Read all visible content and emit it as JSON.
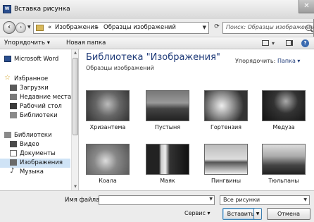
{
  "window": {
    "title": "Вставка рисунка",
    "close_glyph": "✕"
  },
  "address": {
    "prefix": "«",
    "crumbs": [
      "Изображения",
      "Образцы изображений"
    ],
    "separator": "▸"
  },
  "search": {
    "placeholder": "Поиск: Образцы изображений"
  },
  "toolbar": {
    "organize": "Упорядочить ▾",
    "new_folder": "Новая папка"
  },
  "sidebar": {
    "items": [
      {
        "label": "Microsoft Word",
        "icon": "word-icon",
        "bold": true
      },
      {
        "label": "Избранное",
        "icon": "star-icon"
      },
      {
        "label": "Загрузки",
        "icon": "downloads-icon"
      },
      {
        "label": "Недавние места",
        "icon": "recent-places-icon"
      },
      {
        "label": "Рабочий стол",
        "icon": "desktop-icon"
      },
      {
        "label": "Библиотеки",
        "icon": "library-icon"
      },
      {
        "label": "Библиотеки",
        "icon": "library-icon"
      },
      {
        "label": "Видео",
        "icon": "video-icon"
      },
      {
        "label": "Документы",
        "icon": "documents-icon"
      },
      {
        "label": "Изображения",
        "icon": "pictures-icon",
        "selected": true
      },
      {
        "label": "Музыка",
        "icon": "music-icon"
      }
    ]
  },
  "main": {
    "library_title": "Библиотека \"Изображения\"",
    "library_subtitle": "Образцы изображений",
    "arrange_label": "Упорядочить:",
    "arrange_value": "Папка ▾",
    "thumbnails": [
      {
        "caption": "Хризантема",
        "color": "#555555"
      },
      {
        "caption": "Пустыня",
        "color": "#3a3a3a"
      },
      {
        "caption": "Гортензия",
        "color": "#4a4a4a"
      },
      {
        "caption": "Медуза",
        "color": "#222222"
      },
      {
        "caption": "Коала",
        "color": "#6a6a6a"
      },
      {
        "caption": "Маяк",
        "color": "#2e2e2e"
      },
      {
        "caption": "Пингвины",
        "color": "#7a7a7a"
      },
      {
        "caption": "Тюльпаны",
        "color": "#444444"
      }
    ]
  },
  "bottom": {
    "filename_label": "Имя файла:",
    "filename_value": "",
    "filetype_value": "Все рисунки",
    "service_label": "Сервис ▾",
    "insert_label": "Вставить",
    "cancel_label": "Отмена"
  }
}
